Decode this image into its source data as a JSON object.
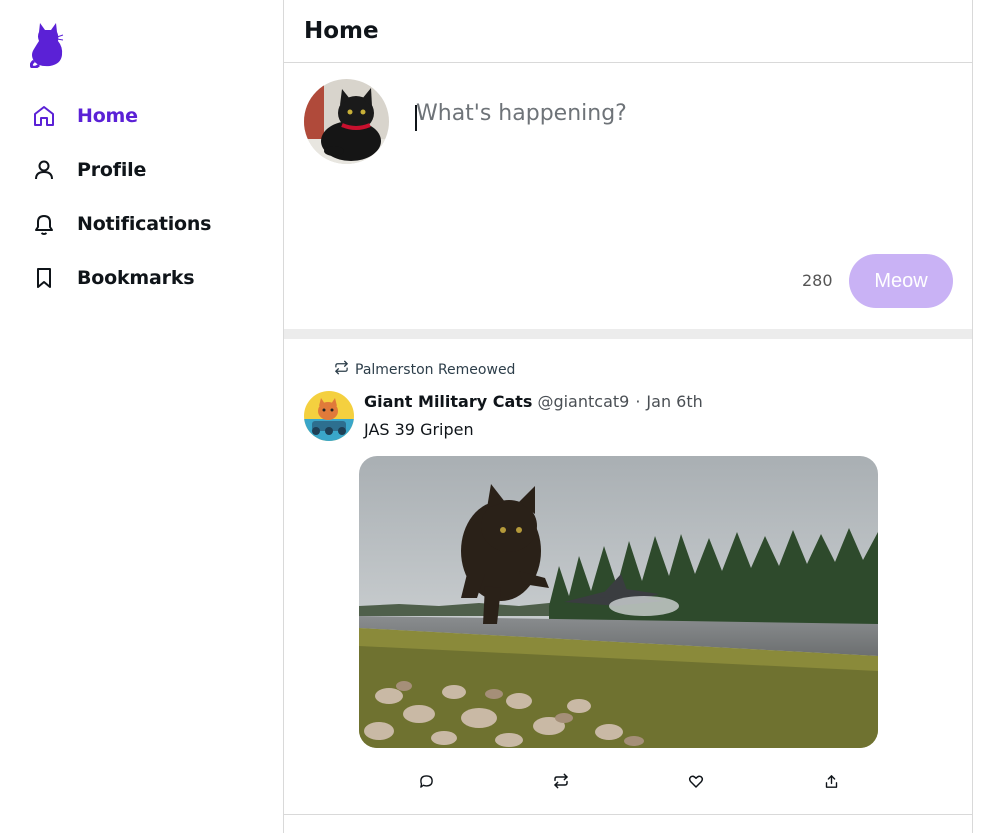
{
  "colors": {
    "accent": "#5b21d6",
    "meow_button": "#c9b2f5",
    "divider": "#ececec",
    "border": "#d9d9d9"
  },
  "sidebar": {
    "logo": "cat-logo-icon",
    "items": [
      {
        "label": "Home",
        "icon": "home-icon",
        "active": true
      },
      {
        "label": "Profile",
        "icon": "person-icon",
        "active": false
      },
      {
        "label": "Notifications",
        "icon": "bell-icon",
        "active": false
      },
      {
        "label": "Bookmarks",
        "icon": "bookmark-icon",
        "active": false
      }
    ]
  },
  "header": {
    "title": "Home"
  },
  "composer": {
    "placeholder": "What's happening?",
    "value": "",
    "char_count": "280",
    "submit_label": "Meow"
  },
  "feed": [
    {
      "remeow_label": "Palmerston Remeowed",
      "author_name": "Giant Military Cats",
      "author_handle": "@giantcat9",
      "separator": "·",
      "date": "Jan 6th",
      "text": "JAS 39 Gripen",
      "actions": [
        "reply-icon",
        "remeow-icon",
        "like-icon",
        "share-icon"
      ]
    }
  ]
}
